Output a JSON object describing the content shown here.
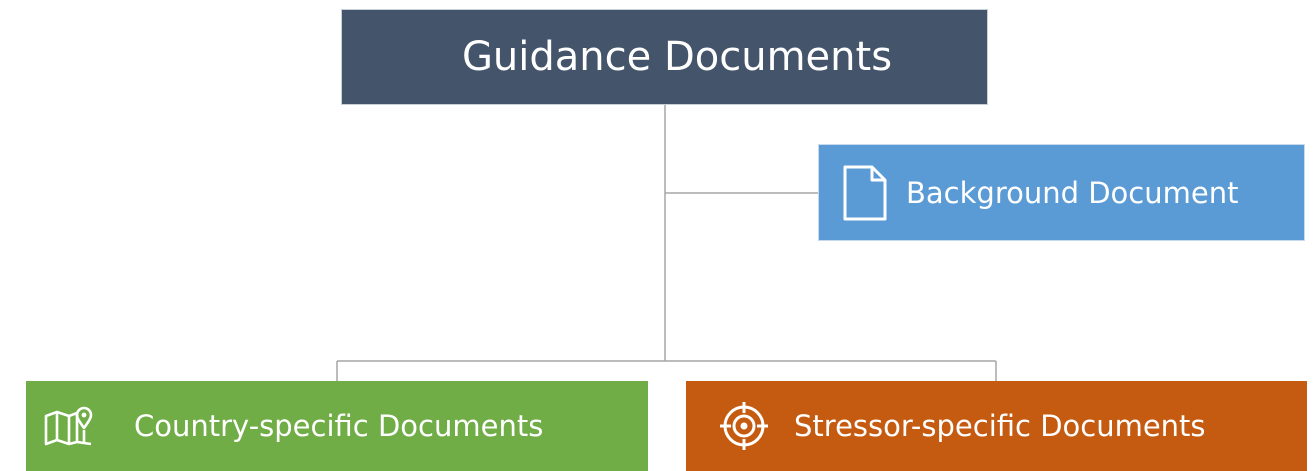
{
  "diagram": {
    "root": {
      "label": "Guidance Documents",
      "color": "#44546a"
    },
    "children": [
      {
        "id": "background",
        "label": "Background Document",
        "icon": "document-icon",
        "color": "#5b9bd5"
      },
      {
        "id": "country",
        "label": "Country-specific Documents",
        "icon": "map-pin-icon",
        "color": "#70ad47"
      },
      {
        "id": "stressor",
        "label": "Stressor-specific Documents",
        "icon": "target-icon",
        "color": "#c55a11"
      }
    ],
    "connector_color": "#a6a6a6"
  }
}
